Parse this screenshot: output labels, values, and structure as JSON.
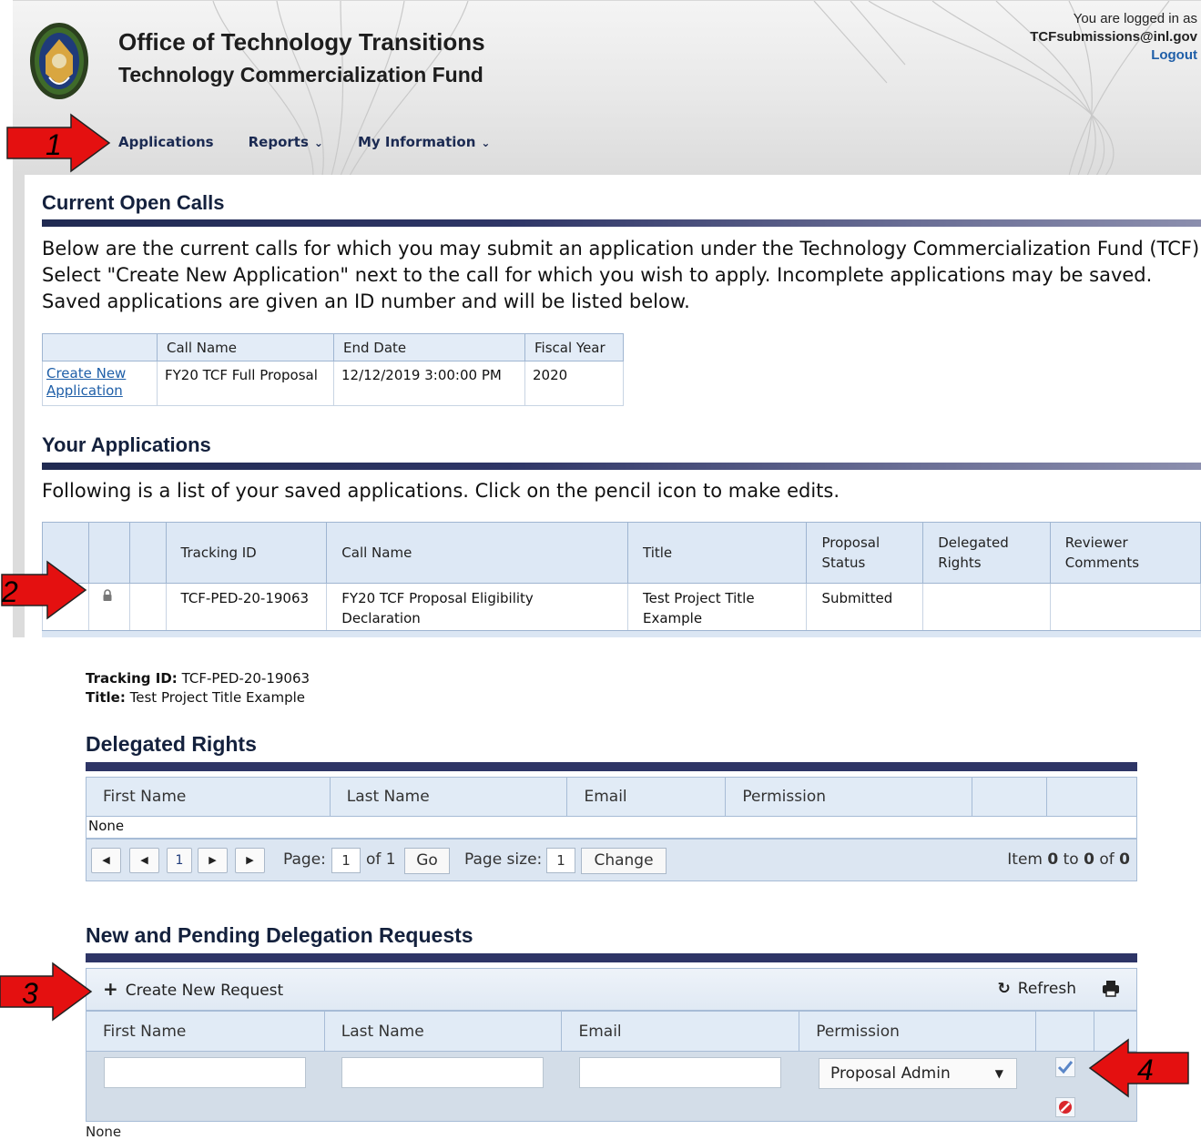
{
  "header": {
    "title": "Office of Technology Transitions",
    "subtitle": "Technology Commercialization Fund",
    "login_prefix": "You are logged in as",
    "login_email": "TCFsubmissions@inl.gov",
    "logout": "Logout"
  },
  "nav": {
    "applications": "Applications",
    "reports": "Reports",
    "my_information": "My Information"
  },
  "open_calls": {
    "heading": "Current Open Calls",
    "intro": "Below are the current calls for which you may submit an application under the Technology Commercialization Fund (TCF).  Select \"Create New Application\" next to the call for which you wish to apply. Incomplete applications may be saved.  Saved applications are given an ID number and will be listed below.",
    "columns": [
      "",
      "Call Name",
      "End Date",
      "Fiscal Year"
    ],
    "rows": [
      {
        "action": "Create New Application",
        "call_name": "FY20 TCF Full Proposal",
        "end_date": "12/12/2019 3:00:00 PM",
        "fiscal_year": "2020"
      }
    ]
  },
  "your_applications": {
    "heading": "Your Applications",
    "intro": "Following is a list of your saved applications. Click on the pencil icon to make edits.",
    "columns": [
      "",
      "",
      "",
      "Tracking ID",
      "Call Name",
      "Title",
      "Proposal Status",
      "Delegated Rights",
      "Reviewer Comments"
    ],
    "rows": [
      {
        "tracking_id": "TCF-PED-20-19063",
        "call_name": "FY20 TCF Proposal Eligibility Declaration",
        "title": "Test Project Title Example",
        "status": "Submitted",
        "delegated_rights": "",
        "reviewer_comments": ""
      }
    ]
  },
  "detail": {
    "tracking_label": "Tracking ID:",
    "tracking_value": "TCF-PED-20-19063",
    "title_label": "Title:",
    "title_value": "Test Project Title Example"
  },
  "delegated_rights": {
    "heading": "Delegated Rights",
    "columns": [
      "First Name",
      "Last Name",
      "Email",
      "Permission",
      "",
      ""
    ],
    "empty": "None",
    "pager": {
      "current_page": "1",
      "page_label": "Page:",
      "page_value": "1",
      "of_label": "of 1",
      "go": "Go",
      "size_label": "Page size:",
      "size_value": "1",
      "change": "Change",
      "item_prefix": "Item",
      "item_from": "0",
      "to_label": "to",
      "item_to": "0",
      "of_word": "of",
      "item_total": "0"
    }
  },
  "pending": {
    "heading": "New and Pending Delegation Requests",
    "create": "Create New Request",
    "refresh": "Refresh",
    "columns": [
      "First Name",
      "Last Name",
      "Email",
      "Permission",
      "",
      ""
    ],
    "permission_selected": "Proposal Admin",
    "empty": "None"
  },
  "annotations": [
    "1",
    "2",
    "3",
    "4"
  ],
  "colors": {
    "navy": "#14213d",
    "link": "#1f5fa8",
    "arrow": "#e41010",
    "table_header": "#e1ebf6"
  }
}
